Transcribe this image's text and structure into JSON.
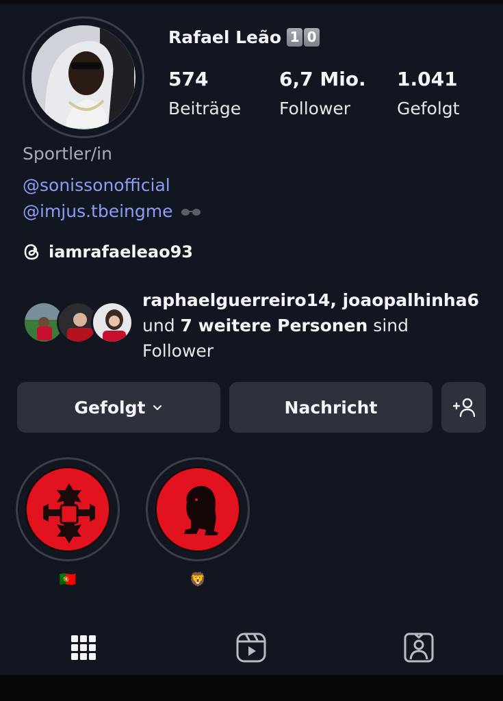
{
  "profile": {
    "username": "Rafael Leão",
    "number_emoji": [
      "1",
      "0"
    ],
    "category": "Sportler/in",
    "links": [
      "@sonissonofficial",
      "@imjus.tbeingme"
    ],
    "link_suffix_icon": "sunglasses-icon",
    "threads_handle": "iamrafaeleao93"
  },
  "stats": [
    {
      "value": "574",
      "label": "Beiträge"
    },
    {
      "value": "6,7 Mio.",
      "label": "Follower"
    },
    {
      "value": "1.041",
      "label": "Gefolgt"
    }
  ],
  "mutual": {
    "names": "raphaelguerreiro14, joaopalhinha6",
    "conjunction": "und",
    "others": "7 weitere Personen",
    "suffix_line1": "sind",
    "suffix_line2": "Follower"
  },
  "actions": {
    "following_label": "Gefolgt",
    "message_label": "Nachricht"
  },
  "highlights": [
    {
      "label": "🇵🇹",
      "icon": "portugal-crest-icon"
    },
    {
      "label": "🦁",
      "icon": "lion-icon"
    }
  ],
  "tabs": [
    "grid-icon",
    "reels-icon",
    "tagged-icon"
  ],
  "colors": {
    "background": "#121620",
    "link": "#8d9cf6",
    "button": "#2c313b",
    "highlight_red": "#e3121f"
  }
}
